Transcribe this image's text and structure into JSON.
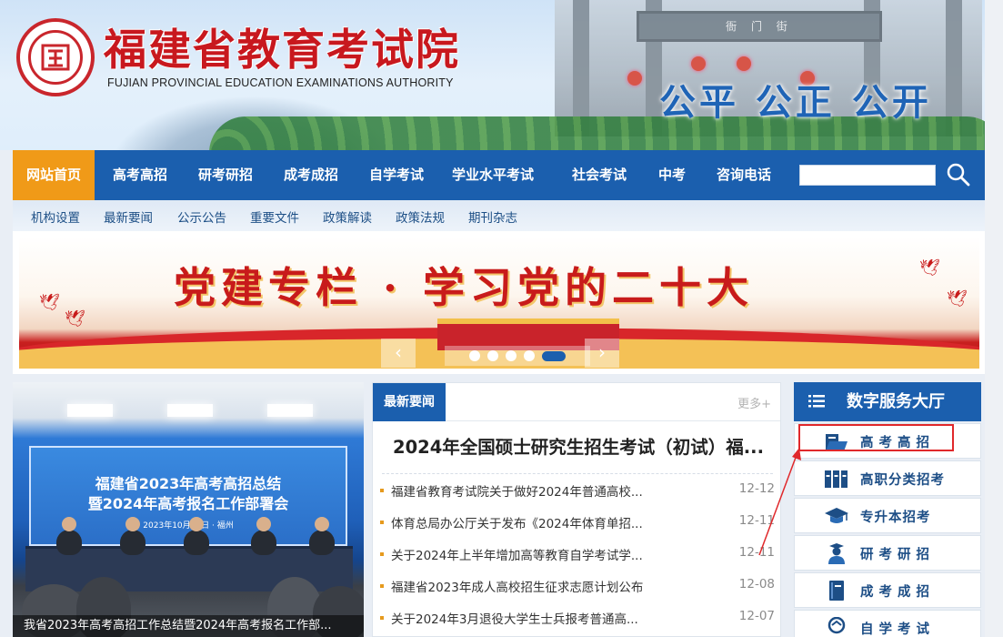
{
  "header": {
    "emblem_text": "福建省教育考试院",
    "title": "福建省教育考试院",
    "subtitle": "FUJIAN PROVINCIAL EDUCATION EXAMINATIONS AUTHORITY",
    "slogan": "公平 公正 公开",
    "gate_inscription": "衙 门 街"
  },
  "mainnav": {
    "items": [
      {
        "label": "网站首页",
        "active": true
      },
      {
        "label": "高考高招"
      },
      {
        "label": "研考研招"
      },
      {
        "label": "成考成招"
      },
      {
        "label": "自学考试"
      },
      {
        "label": "学业水平考试"
      },
      {
        "label": "社会考试"
      },
      {
        "label": "中考"
      },
      {
        "label": "咨询电话"
      }
    ],
    "search_placeholder": ""
  },
  "subnav": {
    "items": [
      "机构设置",
      "最新要闻",
      "公示公告",
      "重要文件",
      "政策解读",
      "政策法规",
      "期刊杂志"
    ]
  },
  "banner": {
    "title": "党建专栏 · 学习党的二十大",
    "prev_label": "‹",
    "next_label": "›",
    "slide_count": 5,
    "active_slide": 5
  },
  "photo": {
    "screen_line1": "福建省2023年高考高招总结",
    "screen_line2": "暨2024年高考报名工作部署会",
    "screen_line3": "2023年10月11日 · 福州",
    "caption": "我省2023年高考高招工作总结暨2024年高考报名工作部..."
  },
  "news": {
    "tab_label": "最新要闻",
    "more_label": "更多+",
    "headline": "2024年全国硕士研究生招生考试（初试）福...",
    "items": [
      {
        "title": "福建省教育考试院关于做好2024年普通高校...",
        "date": "12-12"
      },
      {
        "title": "体育总局办公厅关于发布《2024年体育单招...",
        "date": "12-11"
      },
      {
        "title": "关于2024年上半年增加高等教育自学考试学...",
        "date": "12-11"
      },
      {
        "title": "福建省2023年成人高校招生征求志愿计划公布",
        "date": "12-08"
      },
      {
        "title": "关于2024年3月退役大学生士兵报考普通高...",
        "date": "12-07"
      }
    ]
  },
  "service": {
    "title": "数字服务大厅",
    "items": [
      {
        "label": "高考高招",
        "icon": "book-folder-icon",
        "highlighted": true
      },
      {
        "label": "高职分类招考",
        "icon": "books-icon"
      },
      {
        "label": "专升本招考",
        "icon": "graduation-cap-icon"
      },
      {
        "label": "研考研招",
        "icon": "graduate-person-icon"
      },
      {
        "label": "成考成招",
        "icon": "notebook-icon"
      },
      {
        "label": "自学考试",
        "icon": "self-study-icon"
      }
    ]
  },
  "colors": {
    "brand_blue": "#1b5fae",
    "nav_active": "#f09a18",
    "title_red": "#c8181e",
    "highlight_red": "#e0282b"
  }
}
